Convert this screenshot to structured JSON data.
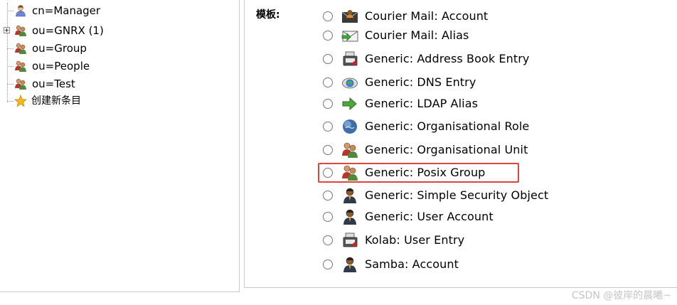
{
  "tree": {
    "items": [
      {
        "label": "cn=Manager",
        "icon": "user-icon"
      },
      {
        "label": "ou=GNRX (1)",
        "icon": "group-icon",
        "expandable": true
      },
      {
        "label": "ou=Group",
        "icon": "group-icon"
      },
      {
        "label": "ou=People",
        "icon": "group-icon"
      },
      {
        "label": "ou=Test",
        "icon": "group-icon"
      },
      {
        "label": "创建新条目",
        "icon": "star-icon"
      }
    ]
  },
  "templates": {
    "label": "模板:",
    "options": [
      {
        "label": "Courier Mail: Account",
        "icon": "mail-user-icon"
      },
      {
        "label": "Courier Mail: Alias",
        "icon": "mail-arrow-icon"
      },
      {
        "label": "Generic: Address Book Entry",
        "icon": "address-book-icon"
      },
      {
        "label": "Generic: DNS Entry",
        "icon": "dns-icon"
      },
      {
        "label": "Generic: LDAP Alias",
        "icon": "arrow-right-icon"
      },
      {
        "label": "Generic: Organisational Role",
        "icon": "globe-icon"
      },
      {
        "label": "Generic: Organisational Unit",
        "icon": "group-icon"
      },
      {
        "label": "Generic: Posix Group",
        "icon": "group-icon",
        "highlighted": true
      },
      {
        "label": "Generic: Simple Security Object",
        "icon": "user-dark-icon"
      },
      {
        "label": "Generic: User Account",
        "icon": "user-dark-icon"
      },
      {
        "label": "Kolab: User Entry",
        "icon": "address-book-icon"
      },
      {
        "label": "Samba: Account",
        "icon": "user-dark-icon"
      }
    ]
  },
  "highlight_color": "#e0453c",
  "watermark": "CSDN @彼岸的晨曦~"
}
